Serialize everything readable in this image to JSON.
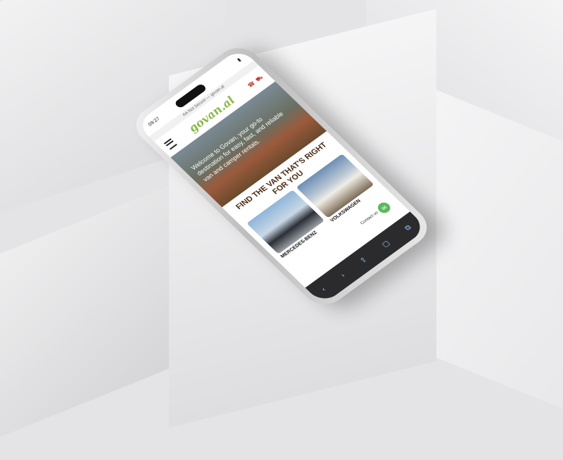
{
  "status": {
    "time": "09:27"
  },
  "browser": {
    "text_size": "AA",
    "url": "Not Secure — govan.al"
  },
  "site": {
    "logo": "govan.al"
  },
  "hero": {
    "text": "Welcome to Govan, your go-to destination for easy, fast, and reliable van and camper rentals."
  },
  "section": {
    "title": "FIND THE VAN THAT'S RIGHT FOR YOU"
  },
  "cards": [
    {
      "label": "MERCEDES-BENZ"
    },
    {
      "label": "VOLKSWAGEN"
    }
  ],
  "contact": {
    "label": "Contact us"
  },
  "icons": {
    "menu": "hamburger-menu-icon",
    "phone": "phone-icon",
    "truck": "truck-icon",
    "chat": "chat-icon",
    "back": "back-icon",
    "forward": "forward-icon",
    "share": "share-icon",
    "bookmarks": "bookmarks-icon",
    "tabs": "tabs-icon"
  },
  "colors": {
    "brand_green": "#8bb84a",
    "title_brown": "#4a2a12",
    "contact_green": "#5cb85c"
  }
}
